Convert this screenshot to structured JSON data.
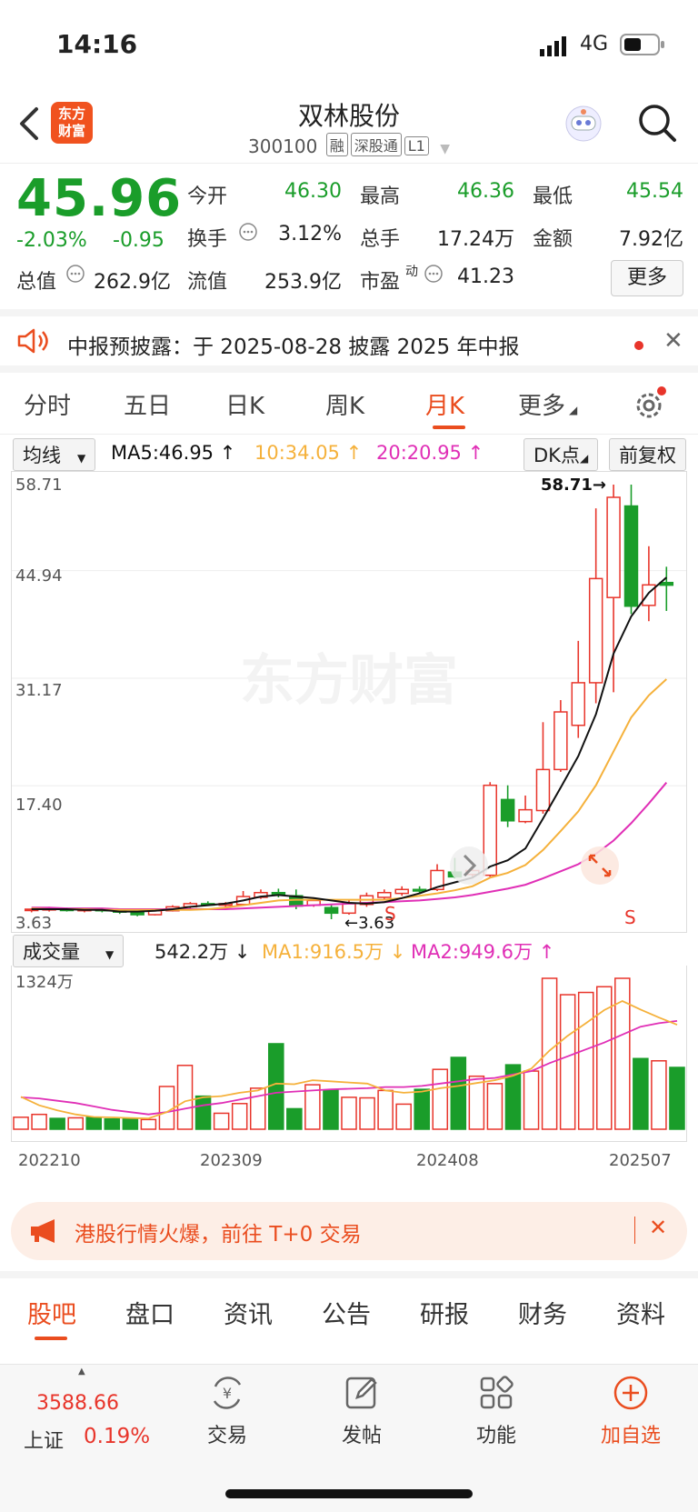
{
  "status": {
    "time": "14:16",
    "network": "4G"
  },
  "header": {
    "logo_line1": "东方",
    "logo_line2": "财富",
    "stock_name": "双林股份",
    "stock_code": "300100",
    "tags": [
      "融",
      "深股通",
      "L1"
    ]
  },
  "quote": {
    "price": "45.96",
    "change_pct": "-2.03%",
    "change": "-0.95",
    "fields": [
      {
        "label": "今开",
        "value": "46.30",
        "color": "green"
      },
      {
        "label": "最高",
        "value": "46.36",
        "color": "green"
      },
      {
        "label": "最低",
        "value": "45.54",
        "color": "green"
      },
      {
        "label": "换手",
        "value": "3.12%",
        "color": "black"
      },
      {
        "label": "总手",
        "value": "17.24万",
        "color": "black"
      },
      {
        "label": "金额",
        "value": "7.92亿",
        "color": "black"
      },
      {
        "label": "总值",
        "value": "262.9亿",
        "color": "black"
      },
      {
        "label": "流值",
        "value": "253.9亿",
        "color": "black"
      },
      {
        "label": "市盈",
        "value": "41.23",
        "color": "black"
      }
    ],
    "pe_superscript": "动",
    "more_label": "更多"
  },
  "notice": {
    "text": "中报预披露：于 2025-08-28 披露 2025 年中报"
  },
  "tabs": [
    "分时",
    "五日",
    "日K",
    "周K",
    "月K",
    "更多"
  ],
  "active_tab": "月K",
  "chart_toolbar": {
    "indicator": "均线",
    "ma5": "MA5:46.95",
    "ma10": "10:34.05",
    "ma20": "20:20.95",
    "dk": "DK点",
    "adjust": "前复权"
  },
  "colors": {
    "up": "#e8352b",
    "down": "#1a9d2a",
    "ma5": "#111111",
    "ma10": "#f5b13b",
    "ma20": "#e02fb6",
    "accent": "#ea4d1f"
  },
  "chart_data": [
    {
      "type": "candlestick",
      "y_ticks": [
        "58.71",
        "44.94",
        "31.17",
        "17.40",
        "3.63"
      ],
      "ylim": [
        3.63,
        58.71
      ],
      "annotations": {
        "high": "58.71→",
        "low": "←3.63",
        "s1": "S",
        "s2": "S"
      },
      "candles": [
        {
          "o": 4.8,
          "c": 4.9,
          "h": 5.0,
          "l": 4.5
        },
        {
          "o": 4.8,
          "c": 5.0,
          "h": 5.2,
          "l": 4.6
        },
        {
          "o": 4.9,
          "c": 4.8,
          "h": 5.1,
          "l": 4.6
        },
        {
          "o": 4.7,
          "c": 4.9,
          "h": 5.0,
          "l": 4.5
        },
        {
          "o": 4.9,
          "c": 4.7,
          "h": 5.0,
          "l": 4.5
        },
        {
          "o": 4.7,
          "c": 4.6,
          "h": 4.9,
          "l": 4.3
        },
        {
          "o": 4.5,
          "c": 4.2,
          "h": 4.6,
          "l": 4.0
        },
        {
          "o": 4.2,
          "c": 4.7,
          "h": 4.9,
          "l": 4.1
        },
        {
          "o": 4.7,
          "c": 5.2,
          "h": 5.4,
          "l": 4.6
        },
        {
          "o": 5.2,
          "c": 5.6,
          "h": 5.8,
          "l": 5.0
        },
        {
          "o": 5.6,
          "c": 5.5,
          "h": 5.9,
          "l": 5.3
        },
        {
          "o": 5.4,
          "c": 5.6,
          "h": 5.8,
          "l": 5.2
        },
        {
          "o": 5.5,
          "c": 6.5,
          "h": 7.2,
          "l": 5.3
        },
        {
          "o": 6.4,
          "c": 7.0,
          "h": 7.4,
          "l": 6.2
        },
        {
          "o": 7.0,
          "c": 6.8,
          "h": 7.5,
          "l": 6.4
        },
        {
          "o": 6.6,
          "c": 5.3,
          "h": 7.4,
          "l": 4.9
        },
        {
          "o": 5.4,
          "c": 6.0,
          "h": 6.4,
          "l": 5.2
        },
        {
          "o": 5.1,
          "c": 4.4,
          "h": 5.5,
          "l": 3.63
        },
        {
          "o": 4.4,
          "c": 5.6,
          "h": 6.0,
          "l": 4.2
        },
        {
          "o": 5.5,
          "c": 6.6,
          "h": 7.0,
          "l": 5.2
        },
        {
          "o": 6.4,
          "c": 7.0,
          "h": 7.4,
          "l": 6.0
        },
        {
          "o": 6.9,
          "c": 7.4,
          "h": 7.8,
          "l": 6.6
        },
        {
          "o": 7.4,
          "c": 7.2,
          "h": 7.8,
          "l": 6.8
        },
        {
          "o": 7.4,
          "c": 9.8,
          "h": 10.6,
          "l": 7.2
        },
        {
          "o": 9.6,
          "c": 9.0,
          "h": 11.4,
          "l": 8.8
        },
        {
          "o": 9.3,
          "c": 9.8,
          "h": 10.4,
          "l": 9.0
        },
        {
          "o": 9.2,
          "c": 20.6,
          "h": 21.0,
          "l": 9.0
        },
        {
          "o": 18.8,
          "c": 16.1,
          "h": 20.6,
          "l": 15.3
        },
        {
          "o": 16.0,
          "c": 17.5,
          "h": 19.3,
          "l": 15.8
        },
        {
          "o": 17.4,
          "c": 22.6,
          "h": 28.6,
          "l": 17.0
        },
        {
          "o": 22.6,
          "c": 29.9,
          "h": 31.4,
          "l": 22.3
        },
        {
          "o": 28.2,
          "c": 33.6,
          "h": 38.9,
          "l": 26.6
        },
        {
          "o": 33.6,
          "c": 46.8,
          "h": 55.7,
          "l": 31.0
        },
        {
          "o": 44.4,
          "c": 57.1,
          "h": 58.71,
          "l": 32.4
        },
        {
          "o": 56.0,
          "c": 43.3,
          "h": 58.71,
          "l": 42.3
        },
        {
          "o": 43.4,
          "c": 46.0,
          "h": 50.9,
          "l": 41.4
        },
        {
          "o": 46.3,
          "c": 45.96,
          "h": 48.3,
          "l": 42.7
        }
      ],
      "ma5": [
        4.9,
        4.9,
        4.9,
        4.8,
        4.8,
        4.6,
        4.6,
        4.7,
        4.9,
        5.2,
        5.4,
        5.6,
        6.0,
        6.5,
        6.7,
        6.5,
        6.3,
        6.0,
        5.7,
        5.6,
        5.8,
        6.3,
        6.9,
        7.7,
        8.3,
        8.9,
        10.3,
        11.1,
        12.6,
        16.4,
        20.3,
        24.3,
        29.6,
        37.3,
        42.0,
        45.0,
        46.95
      ],
      "ma10": [
        5.0,
        4.9,
        4.9,
        4.9,
        4.8,
        4.8,
        4.8,
        4.8,
        4.8,
        4.8,
        4.9,
        5.1,
        5.4,
        5.7,
        6.0,
        6.1,
        6.1,
        6.1,
        6.1,
        6.1,
        6.1,
        6.3,
        6.6,
        6.9,
        7.3,
        7.8,
        8.9,
        9.5,
        10.5,
        12.4,
        14.8,
        17.3,
        20.6,
        24.9,
        29.2,
        32.0,
        34.05
      ],
      "ma20": [
        5.1,
        5.1,
        5.0,
        5.0,
        5.0,
        4.9,
        4.9,
        4.9,
        4.9,
        4.9,
        4.9,
        4.9,
        5.0,
        5.1,
        5.2,
        5.3,
        5.4,
        5.5,
        5.6,
        5.7,
        5.8,
        5.9,
        6.0,
        6.2,
        6.4,
        6.7,
        7.1,
        7.5,
        8.0,
        8.8,
        9.7,
        10.6,
        11.9,
        13.6,
        15.8,
        18.3,
        20.95
      ]
    },
    {
      "type": "bar",
      "title": "成交量",
      "y_ticks": [
        "1324万"
      ],
      "ylim": [
        0,
        1324
      ],
      "legend": {
        "vol": "542.2万",
        "ma1": "MA1:916.5万",
        "ma2": "MA2:949.6万"
      },
      "x_ticks": [
        "202210",
        "202309",
        "202408",
        "202507"
      ],
      "volumes": [
        105,
        130,
        95,
        100,
        105,
        90,
        95,
        85,
        375,
        560,
        290,
        140,
        225,
        360,
        750,
        180,
        390,
        345,
        280,
        275,
        340,
        220,
        350,
        525,
        630,
        465,
        400,
        565,
        510,
        1324,
        1180,
        1200,
        1250,
        1324,
        620,
        600,
        542.2
      ],
      "ma1": [
        285,
        210,
        165,
        130,
        108,
        104,
        98,
        95,
        150,
        245,
        280,
        290,
        320,
        340,
        400,
        395,
        430,
        420,
        410,
        400,
        340,
        320,
        330,
        360,
        380,
        405,
        430,
        470,
        530,
        690,
        820,
        930,
        1045,
        1125,
        1050,
        980,
        916.5
      ],
      "ma2": [
        280,
        270,
        250,
        230,
        200,
        170,
        150,
        130,
        150,
        180,
        210,
        230,
        260,
        290,
        320,
        330,
        340,
        350,
        355,
        360,
        370,
        370,
        380,
        400,
        420,
        440,
        450,
        480,
        510,
        580,
        640,
        700,
        760,
        830,
        900,
        930,
        949.6
      ]
    }
  ],
  "promo": {
    "text": "港股行情火爆，前往 T+0 交易"
  },
  "bottom_tabs": [
    "股吧",
    "盘口",
    "资讯",
    "公告",
    "研报",
    "财务",
    "资料"
  ],
  "active_bottom_tab": "股吧",
  "bottom_nav": {
    "index_value": "3588.66",
    "index_name": "上证",
    "index_pct": "0.19%",
    "items": [
      "交易",
      "发帖",
      "功能",
      "加自选"
    ]
  }
}
